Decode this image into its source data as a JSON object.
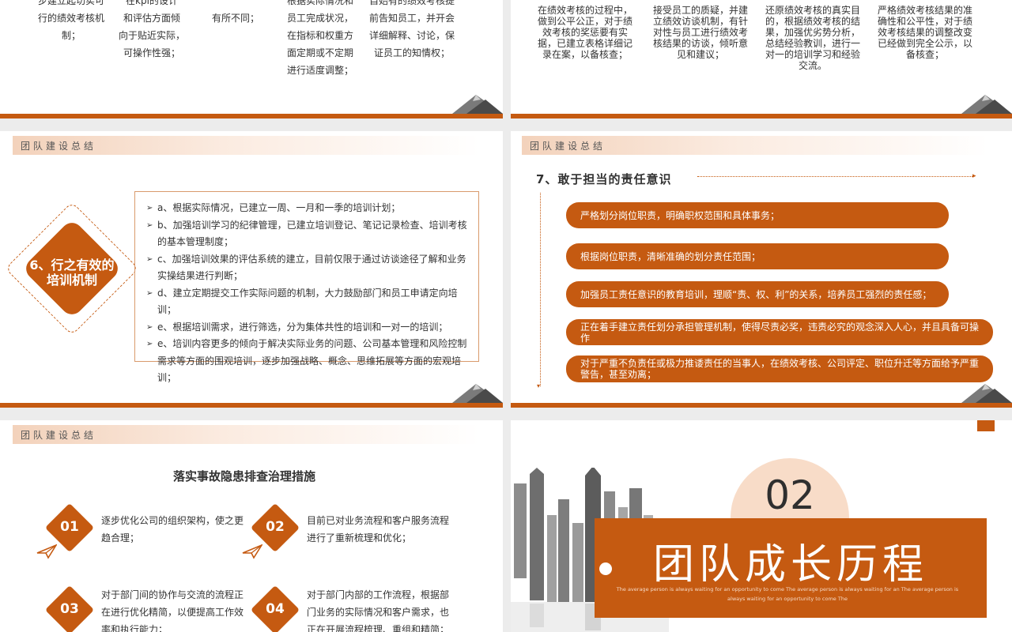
{
  "slide_a": {
    "columns": [
      [
        "步建立起切实可",
        "行的绩效考核机",
        "制；"
      ],
      [
        "在kpi的设计",
        "和评估方面倾",
        "向于贴近实际，",
        "可操作性强；"
      ],
      [
        "有所不同；"
      ],
      [
        "根据实际情况和",
        "员工完成状况，",
        "在指标和权重方",
        "面定期或不定期",
        "进行适度调整；"
      ],
      [
        "自始有的绩效考核提",
        "前告知员工，并开会",
        "详细解释、讨论，保",
        "证员工的知情权；"
      ]
    ]
  },
  "slide_b": {
    "columns": [
      "在绩效考核的过程中，做到公平公正，对于绩效考核的奖惩要有实据，已建立表格详细记录在案，以备核查；",
      "接受员工的质疑，并建立绩效访谈机制，有针对性与员工进行绩效考核结果的访谈，倾听意见和建议；",
      "还原绩效考核的真实目的，根据绩效考核的结果，加强优劣势分析，总结经验教训，进行一对一的培训学习和经验交流。",
      "严格绩效考核结果的准确性和公平性，对于绩效考核结果的调整改变已经做到完全公示，以备核查；"
    ]
  },
  "slide_c": {
    "header": "团队建设总结",
    "diamond_label": "6、行之有效的培训机制",
    "items": [
      "a、根据实际情况，已建立一周、一月和一季的培训计划；",
      "b、加强培训学习的纪律管理，已建立培训登记、笔记记录检查、培训考核的基本管理制度；",
      "c、加强培训效果的评估系统的建立，目前仅限于通过访谈途径了解和业务实操结果进行判断；",
      "d、建立定期提交工作实际问题的机制，大力鼓励部门和员工申请定向培训；",
      "e、根据培训需求，进行筛选，分为集体共性的培训和一对一的培训；",
      "e、培训内容更多的倾向于解决实际业务的问题、公司基本管理和风险控制需求等方面的围观培训，逐步加强战略、概念、思维拓展等方面的宏观培训；"
    ]
  },
  "slide_d": {
    "header": "团队建设总结",
    "title": "7、敢于担当的责任意识",
    "pills": [
      "严格划分岗位职责，明确职权范围和具体事务；",
      "根据岗位职责，清晰准确的划分责任范围；",
      "加强员工责任意识的教育培训，理顺“责、权、利”的关系，培养员工强烈的责任感；",
      "正在着手建立责任划分承担管理机制，使得尽责必奖，违责必究的观念深入人心，并且具备可操作",
      "对于严重不负责任或极力推诿责任的当事人，在绩效考核、公司评定、职位升迁等方面给予严重警告，甚至劝离；"
    ]
  },
  "slide_e": {
    "header": "团队建设总结",
    "title": "落实事故隐患排查治理措施",
    "items": [
      {
        "num": "01",
        "text": "逐步优化公司的组织架构，使之更趋合理；"
      },
      {
        "num": "02",
        "text": "目前已对业务流程和客户服务流程进行了重新梳理和优化；"
      },
      {
        "num": "03",
        "text": "对于部门间的协作与交流的流程正在进行优化精简，以便提高工作效率和执行能力；"
      },
      {
        "num": "04",
        "text": "对于部门内部的工作流程，根据部门业务的实际情况和客户需求，也正在开展流程梳理、重组和精简；"
      }
    ]
  },
  "slide_f": {
    "number": "02",
    "title": "团队成长历程",
    "subtitle": "The average person is always waiting for an opportunity to come The average person is always waiting for an The average person is always waiting for an opportunity to come The"
  },
  "colors": {
    "accent": "#c55a11",
    "light_accent": "#f8dcc8"
  }
}
